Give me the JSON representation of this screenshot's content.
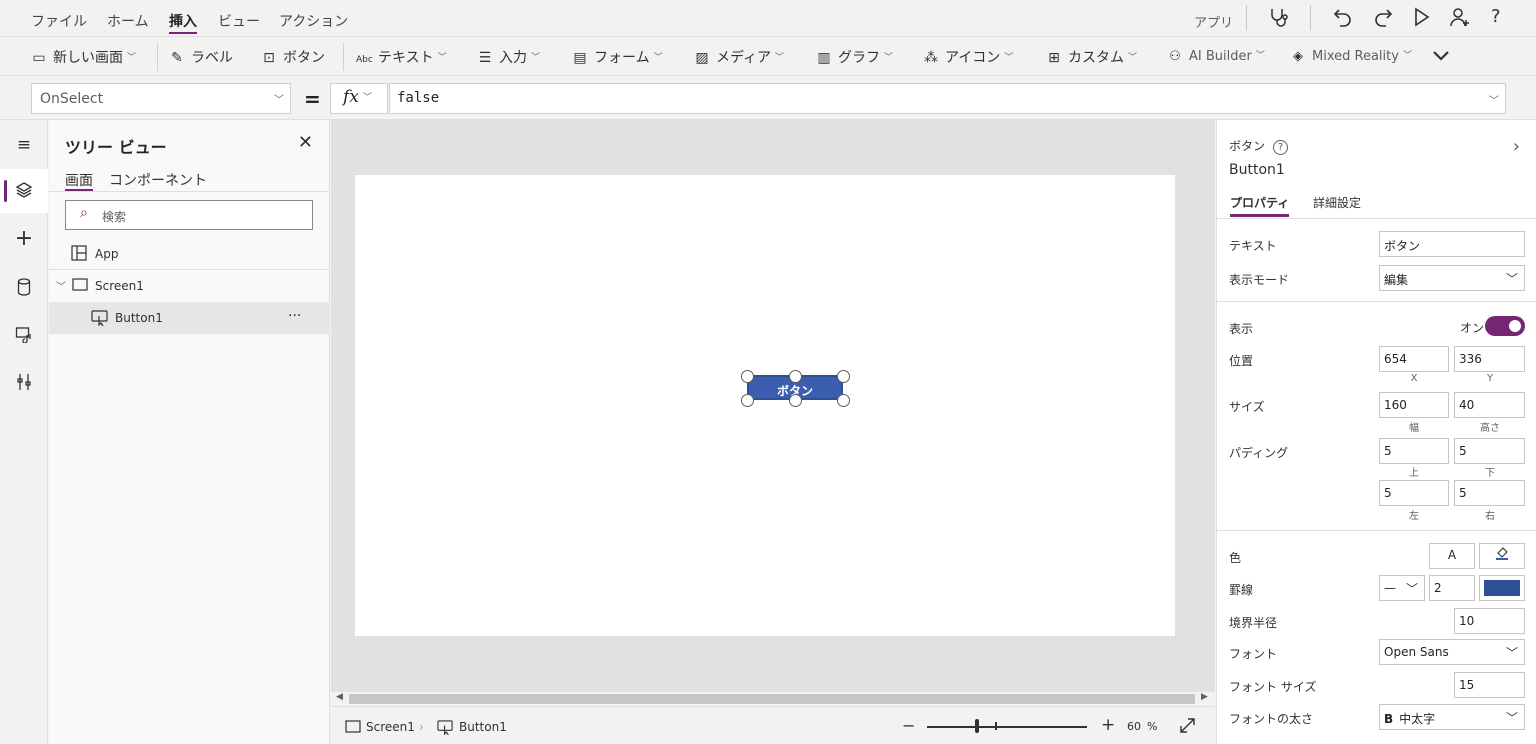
{
  "menu": {
    "items": [
      "ファイル",
      "ホーム",
      "挿入",
      "ビュー",
      "アクション"
    ],
    "right_label": "アプリ"
  },
  "ribbon": {
    "new_screen": "新しい画面",
    "label": "ラベル",
    "button": "ボタン",
    "text": "テキスト",
    "input": "入力",
    "form": "フォーム",
    "media": "メディア",
    "chart": "グラフ",
    "icons": "アイコン",
    "custom": "カスタム",
    "ai_builder": "AI Builder",
    "mixed_reality": "Mixed Reality"
  },
  "formula": {
    "property": "OnSelect",
    "equals": "=",
    "fx": "fx",
    "value": "false"
  },
  "tree": {
    "title": "ツリー ビュー",
    "tabs": [
      "画面",
      "コンポーネント"
    ],
    "search_placeholder": "検索",
    "items": [
      "App",
      "Screen1",
      "Button1"
    ],
    "more": "···"
  },
  "canvas": {
    "button_text": "ボタン"
  },
  "status": {
    "screen": "Screen1",
    "control": "Button1",
    "zoom_minus": "−",
    "zoom_plus": "+",
    "zoom_value": "60",
    "zoom_unit": "%",
    "zoom_level": 0.3
  },
  "props": {
    "type": "ボタン",
    "name": "Button1",
    "tabs": [
      "プロパティ",
      "詳細設定"
    ],
    "text_label": "テキスト",
    "text_value": "ボタン",
    "display_mode_label": "表示モード",
    "display_mode_value": "編集",
    "visible_label": "表示",
    "visible_value": "オン",
    "position_label": "位置",
    "x": "654",
    "y": "336",
    "x_label": "X",
    "y_label": "Y",
    "size_label": "サイズ",
    "width": "160",
    "height": "40",
    "width_label": "幅",
    "height_label": "高さ",
    "padding_label": "パディング",
    "pad_top": "5",
    "pad_bottom": "5",
    "pad_left": "5",
    "pad_right": "5",
    "pad_top_label": "上",
    "pad_bottom_label": "下",
    "pad_left_label": "左",
    "pad_right_label": "右",
    "color_label": "色",
    "color_text": "A",
    "border_label": "罫線",
    "border_width": "2",
    "border_color": "#2f4f97",
    "radius_label": "境界半径",
    "radius_value": "10",
    "font_label": "フォント",
    "font_value": "Open Sans",
    "font_size_label": "フォント サイズ",
    "font_size_value": "15",
    "font_weight_label": "フォントの太さ",
    "font_weight_value": "中太字",
    "font_weight_icon": "B"
  },
  "colors": {
    "accent": "#742774",
    "button_fill": "#3b5fae"
  }
}
